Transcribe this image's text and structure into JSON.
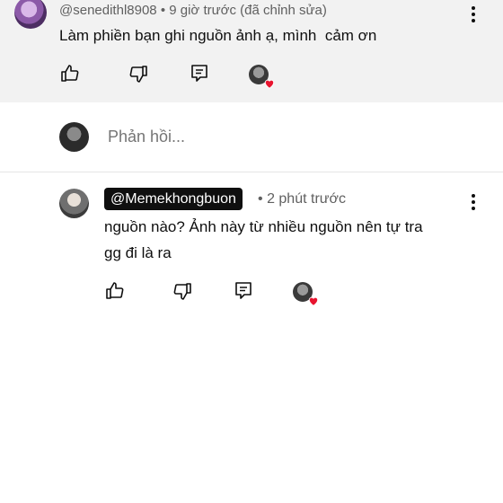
{
  "parent_comment": {
    "handle": "@senedithl8908",
    "time": "9 giờ trước (đã chỉnh sửa)",
    "separator": "•",
    "text": "Làm phiền bạn ghi nguồn ảnh ạ, mình  cảm ơn",
    "icons": [
      "like-icon",
      "dislike-icon",
      "reply-icon",
      "creator-heart-icon",
      "more-vert-icon"
    ]
  },
  "reply_box": {
    "placeholder": "Phản hồi..."
  },
  "reply_comment": {
    "handle": "@Memekhongbuon",
    "separator": "•",
    "time": "2 phút trước",
    "text_line1": "nguồn nào? Ảnh này từ nhiều nguồn nên tự tra",
    "text_line2": "gg đi là ra",
    "icons": [
      "like-icon",
      "dislike-icon",
      "reply-icon",
      "creator-heart-icon",
      "more-vert-icon"
    ]
  },
  "colors": {
    "parent_bg": "#f2f2f2",
    "heart": "#e8142f",
    "badge_bg": "#0f0f0f",
    "meta_text": "#606060"
  }
}
